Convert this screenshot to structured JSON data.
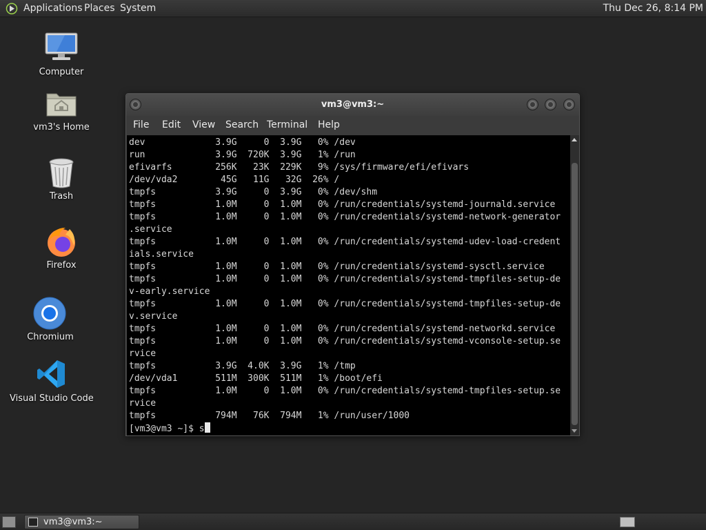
{
  "top_panel": {
    "menus": [
      "Applications",
      "Places",
      "System"
    ],
    "clock": "Thu Dec 26,  8:14 PM"
  },
  "desktop_icons": [
    {
      "label": "Computer",
      "icon": "computer-icon"
    },
    {
      "label": "vm3's Home",
      "icon": "home-folder-icon"
    },
    {
      "label": "Trash",
      "icon": "trash-icon"
    },
    {
      "label": "Firefox",
      "icon": "firefox-icon"
    },
    {
      "label": "Chromium",
      "icon": "chromium-icon"
    },
    {
      "label": "Visual Studio Code",
      "icon": "vscode-icon"
    }
  ],
  "terminal": {
    "title": "vm3@vm3:~",
    "menu": [
      "File",
      "Edit",
      "View",
      "Search",
      "Terminal",
      "Help"
    ],
    "lines": [
      "dev             3.9G     0  3.9G   0% /dev",
      "run             3.9G  720K  3.9G   1% /run",
      "efivarfs        256K   23K  229K   9% /sys/firmware/efi/efivars",
      "/dev/vda2        45G   11G   32G  26% /",
      "tmpfs           3.9G     0  3.9G   0% /dev/shm",
      "tmpfs           1.0M     0  1.0M   0% /run/credentials/systemd-journald.service",
      "tmpfs           1.0M     0  1.0M   0% /run/credentials/systemd-network-generator",
      ".service",
      "tmpfs           1.0M     0  1.0M   0% /run/credentials/systemd-udev-load-credent",
      "ials.service",
      "tmpfs           1.0M     0  1.0M   0% /run/credentials/systemd-sysctl.service",
      "tmpfs           1.0M     0  1.0M   0% /run/credentials/systemd-tmpfiles-setup-de",
      "v-early.service",
      "tmpfs           1.0M     0  1.0M   0% /run/credentials/systemd-tmpfiles-setup-de",
      "v.service",
      "tmpfs           1.0M     0  1.0M   0% /run/credentials/systemd-networkd.service",
      "tmpfs           1.0M     0  1.0M   0% /run/credentials/systemd-vconsole-setup.se",
      "rvice",
      "tmpfs           3.9G  4.0K  3.9G   1% /tmp",
      "/dev/vda1       511M  300K  511M   1% /boot/efi",
      "tmpfs           1.0M     0  1.0M   0% /run/credentials/systemd-tmpfiles-setup.se",
      "rvice",
      "tmpfs           794M   76K  794M   1% /run/user/1000"
    ],
    "prompt": "[vm3@vm3 ~]$ ",
    "input": "s"
  },
  "taskbar": {
    "window_button": "vm3@vm3:~"
  }
}
